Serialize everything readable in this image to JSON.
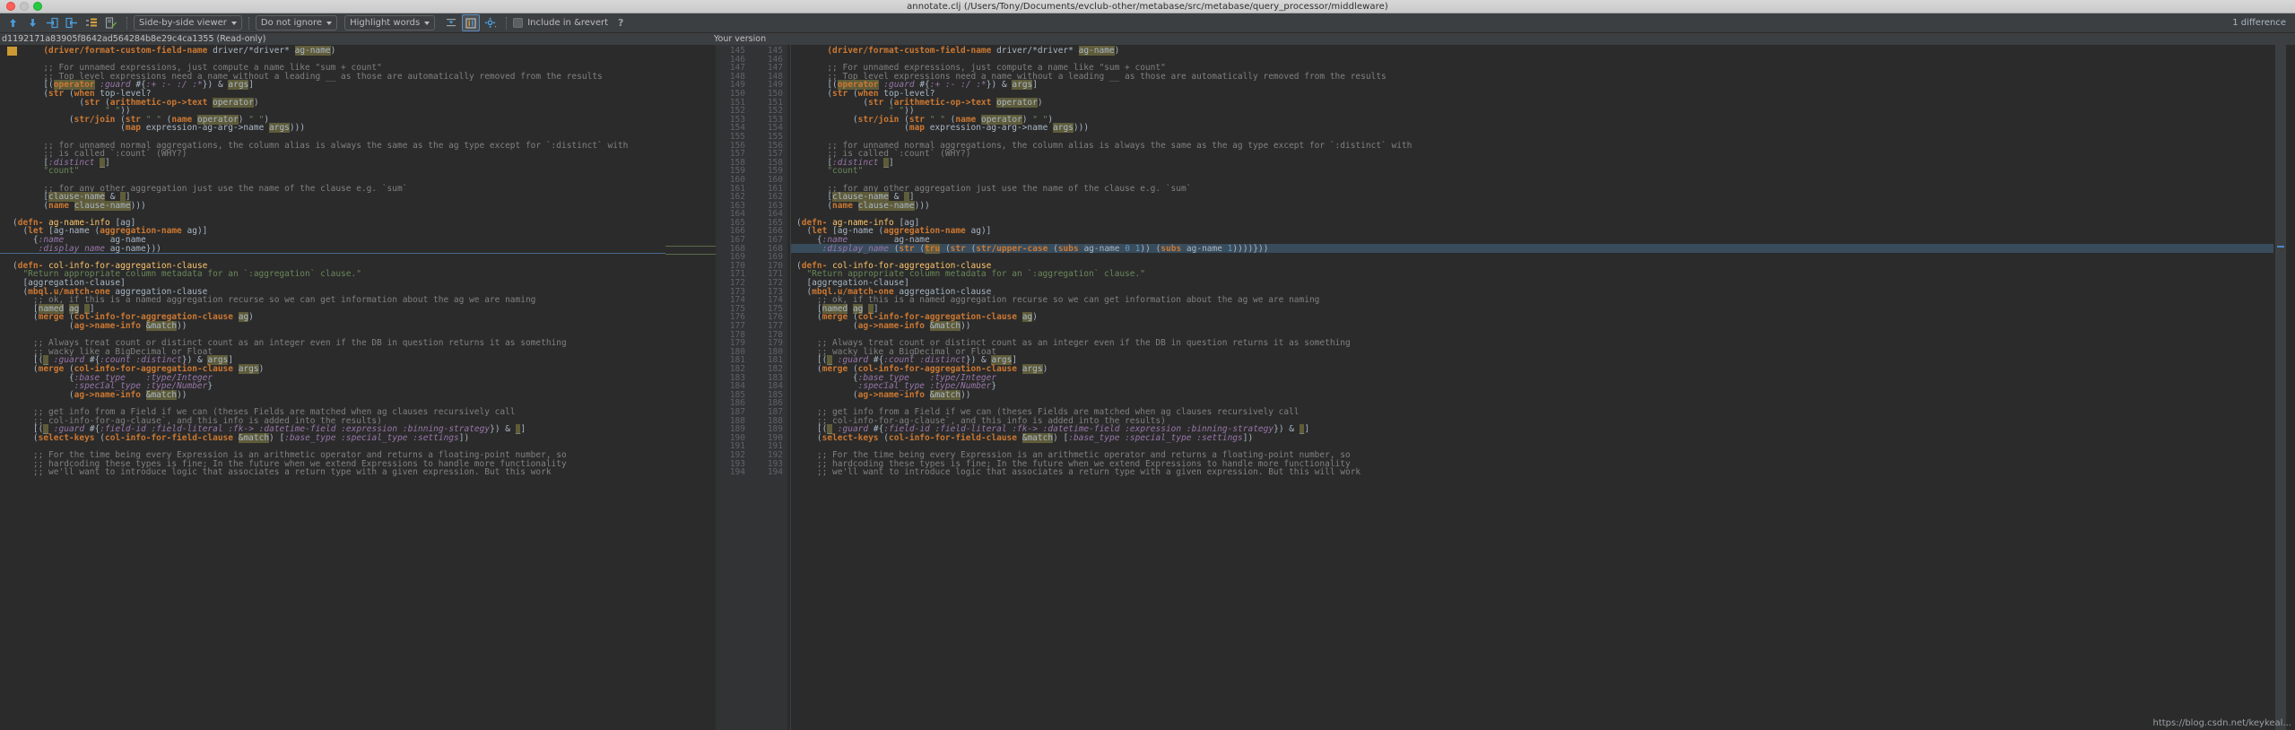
{
  "window": {
    "title": "annotate.clj (/Users/Tony/Documents/evclub-other/metabase/src/metabase/query_processor/middleware)",
    "traffic_lights": [
      "close",
      "minimize",
      "zoom"
    ]
  },
  "toolbar": {
    "icons": [
      {
        "name": "previous-difference-icon",
        "glyph": "arrow-up"
      },
      {
        "name": "next-difference-icon",
        "glyph": "arrow-down"
      },
      {
        "name": "accept-left-icon",
        "glyph": "arrow-to-left"
      },
      {
        "name": "accept-right-icon",
        "glyph": "arrow-to-right"
      },
      {
        "name": "collapse-unchanged-icon",
        "glyph": "collapse"
      },
      {
        "name": "edit-source-icon",
        "glyph": "pencil"
      }
    ],
    "viewer_mode": "Side-by-side viewer",
    "ignore_policy": "Do not ignore",
    "highlight_policy": "Highlight words",
    "toggle_icons": [
      {
        "name": "collapse-lines-icon",
        "glyph": "collapse-lines",
        "active": false
      },
      {
        "name": "show-diff-markers-icon",
        "glyph": "diff-markers",
        "active": true
      },
      {
        "name": "settings-gear-icon",
        "glyph": "gear",
        "active": false
      }
    ],
    "include_in_revert_label": "Include in &revert",
    "include_in_revert_checked": false,
    "help_label": "?",
    "difference_count": "1 difference"
  },
  "panes": {
    "left_header": "d1192171a83905f8642ad564284b8e29c4ca1355 (Read-only)",
    "right_header": "Your version"
  },
  "left_code": [
    {
      "ln": "",
      "html": "      <span class=\"c-fn\">(driver/format-custom-field-name</span> driver/*driver* <span class=\"hl\">ag-name</span>)"
    },
    {
      "ln": "",
      "html": ""
    },
    {
      "ln": "",
      "html": "      <span class=\"c-comment\">;; For unnamed expressions, just compute a name like \"sum + count\"</span>"
    },
    {
      "ln": "",
      "html": "      <span class=\"c-comment\">;; Top level expressions need a name without a leading __ as those are automatically removed from the results</span>"
    },
    {
      "ln": "",
      "html": "      [(<span class=\"hl c-fn\">operator</span> <span class=\"c-key\">:guard</span> #{<span class=\"c-key\">:+</span> <span class=\"c-key\">:-</span> <span class=\"c-key\">:/</span> <span class=\"c-key\">:*</span>}) &amp; <span class=\"hl\">args</span>]"
    },
    {
      "ln": "",
      "html": "      (<span class=\"c-fn\">str</span> (<span class=\"c-kw\">when</span> top-level?"
    },
    {
      "ln": "",
      "html": "             (<span class=\"c-fn\">str</span> (<span class=\"c-fn\">arithmetic-op-&gt;text</span> <span class=\"hl\">operator</span>)"
    },
    {
      "ln": "",
      "html": "                  <span class=\"c-str\">\" \"</span>))"
    },
    {
      "ln": "",
      "html": "           (<span class=\"c-fn\">str/join</span> (<span class=\"c-fn\">str</span> <span class=\"c-str\">\" \"</span> (<span class=\"c-fn\">name</span> <span class=\"hl\">operator</span>) <span class=\"c-str\">\" \"</span>)"
    },
    {
      "ln": "",
      "html": "                     (<span class=\"c-fn\">map</span> expression-ag-arg-&gt;name <span class=\"hl\">args</span>)))"
    },
    {
      "ln": "",
      "html": ""
    },
    {
      "ln": "",
      "html": "      <span class=\"c-comment\">;; for unnamed normal aggregations, the column alias is always the same as the ag type except for `:distinct` with</span>"
    },
    {
      "ln": "",
      "html": "      <span class=\"c-comment\">;; is called `:count` (WHY?)</span>"
    },
    {
      "ln": "",
      "html": "      [<span class=\"c-key\">:distinct</span> <span class=\"hl\">_</span>]"
    },
    {
      "ln": "",
      "html": "      <span class=\"c-str\">\"count\"</span>"
    },
    {
      "ln": "",
      "html": ""
    },
    {
      "ln": "",
      "html": "      <span class=\"c-comment\">;; for any other aggregation just use the name of the clause e.g. `sum`</span>"
    },
    {
      "ln": "",
      "html": "      [<span class=\"hl\">clause-name</span> &amp; <span class=\"hl\">_</span>]"
    },
    {
      "ln": "",
      "html": "      (<span class=\"c-fn\">name</span> <span class=\"hl\">clause-name</span>)))"
    },
    {
      "ln": "",
      "html": ""
    },
    {
      "ln": "",
      "html": "(<span class=\"c-kw\">defn-</span> <span class=\"c-def\">ag-name-info</span> [ag]"
    },
    {
      "ln": "",
      "html": "  (<span class=\"c-kw\">let</span> [ag-name (<span class=\"c-fn\">aggregation-name</span> ag)]"
    },
    {
      "ln": "",
      "html": "    {<span class=\"c-key\">:name</span>         ag-name"
    },
    {
      "ln": "",
      "html": "     <span class=\"c-key\">:display_name</span> ag-name}))"
    },
    {
      "ln": "",
      "html": ""
    },
    {
      "ln": "",
      "html": "(<span class=\"c-kw\">defn-</span> <span class=\"c-def\">col-info-for-aggregation-clause</span>"
    },
    {
      "ln": "",
      "html": "  <span class=\"c-str\">\"Return appropriate column metadata for an `:aggregation` clause.\"</span>"
    },
    {
      "ln": "",
      "html": "  [aggregation-clause]"
    },
    {
      "ln": "",
      "html": "  (<span class=\"c-fn\">mbql.u/match-one</span> aggregation-clause"
    },
    {
      "ln": "",
      "html": "    <span class=\"c-comment\">;; ok, if this is a named aggregation recurse so we can get information about the ag we are naming</span>"
    },
    {
      "ln": "",
      "html": "    [<span class=\"hl\">named</span> <span class=\"hl\">ag</span> <span class=\"hl\">_</span>]"
    },
    {
      "ln": "",
      "html": "    (<span class=\"c-fn\">merge</span> (<span class=\"c-fn\">col-info-for-aggregation-clause</span> <span class=\"hl\">ag</span>)"
    },
    {
      "ln": "",
      "html": "           (<span class=\"c-fn\">ag-&gt;name-info</span> <span class=\"hl\">&amp;match</span>))"
    },
    {
      "ln": "",
      "html": ""
    },
    {
      "ln": "",
      "html": "    <span class=\"c-comment\">;; Always treat count or distinct count as an integer even if the DB in question returns it as something</span>"
    },
    {
      "ln": "",
      "html": "    <span class=\"c-comment\">;; wacky like a BigDecimal or Float</span>"
    },
    {
      "ln": "",
      "html": "    [(<span class=\"hl\">_</span> <span class=\"c-key\">:guard</span> #{<span class=\"c-key\">:count</span> <span class=\"c-key\">:distinct</span>}) &amp; <span class=\"hl\">args</span>]"
    },
    {
      "ln": "",
      "html": "    (<span class=\"c-fn\">merge</span> (<span class=\"c-fn\">col-info-for-aggregation-clause</span> <span class=\"hl\">args</span>)"
    },
    {
      "ln": "",
      "html": "           {<span class=\"c-key\">:base_type</span>    <span class=\"c-key\">:type/Integer</span>"
    },
    {
      "ln": "",
      "html": "            <span class=\"c-key\">:special_type</span> <span class=\"c-key\">:type/Number</span>}"
    },
    {
      "ln": "",
      "html": "           (<span class=\"c-fn\">ag-&gt;name-info</span> <span class=\"hl\">&amp;match</span>))"
    },
    {
      "ln": "",
      "html": ""
    },
    {
      "ln": "",
      "html": "    <span class=\"c-comment\">;; get info from a Field if we can (theses Fields are matched when ag clauses recursively call</span>"
    },
    {
      "ln": "",
      "html": "    <span class=\"c-comment\">;; col-info-for-ag-clause`, and this info is added into the results)</span>"
    },
    {
      "ln": "",
      "html": "    [(<span class=\"hl\">_</span> <span class=\"c-key\">:guard</span> #{<span class=\"c-key\">:field-id</span> <span class=\"c-key\">:field-literal</span> <span class=\"c-key\">:fk-&gt;</span> <span class=\"c-key\">:datetime-field</span> <span class=\"c-key\">:expression</span> <span class=\"c-key\">:binning-strategy</span>}) &amp; <span class=\"hl\">_</span>]"
    },
    {
      "ln": "",
      "html": "    (<span class=\"c-fn\">select-keys</span> (<span class=\"c-fn\">col-info-for-field-clause</span> <span class=\"hl\">&amp;match</span>) [<span class=\"c-key\">:base_type</span> <span class=\"c-key\">:special_type</span> <span class=\"c-key\">:settings</span>])"
    },
    {
      "ln": "",
      "html": ""
    },
    {
      "ln": "",
      "html": "    <span class=\"c-comment\">;; For the time being every Expression is an arithmetic operator and returns a floating-point number, so</span>"
    },
    {
      "ln": "",
      "html": "    <span class=\"c-comment\">;; hardcoding these types is fine; In the future when we extend Expressions to handle more functionality</span>"
    },
    {
      "ln": "",
      "html": "    <span class=\"c-comment\">;; we'll want to introduce logic that associates a return type with a given expression. But this work</span>"
    }
  ],
  "right_code": [
    {
      "ln": "",
      "html": "      <span class=\"c-fn\">(driver/format-custom-field-name</span> driver/*driver* <span class=\"hl\">ag-name</span>)"
    },
    {
      "ln": "",
      "html": ""
    },
    {
      "ln": "",
      "html": "      <span class=\"c-comment\">;; For unnamed expressions, just compute a name like \"sum + count\"</span>"
    },
    {
      "ln": "",
      "html": "      <span class=\"c-comment\">;; Top level expressions need a name without a leading __ as those are automatically removed from the results</span>"
    },
    {
      "ln": "",
      "html": "      [(<span class=\"hl c-fn\">operator</span> <span class=\"c-key\">:guard</span> #{<span class=\"c-key\">:+</span> <span class=\"c-key\">:-</span> <span class=\"c-key\">:/</span> <span class=\"c-key\">:*</span>}) &amp; <span class=\"hl\">args</span>]"
    },
    {
      "ln": "",
      "html": "      (<span class=\"c-fn\">str</span> (<span class=\"c-kw\">when</span> top-level?"
    },
    {
      "ln": "",
      "html": "             (<span class=\"c-fn\">str</span> (<span class=\"c-fn\">arithmetic-op-&gt;text</span> <span class=\"hl\">operator</span>)"
    },
    {
      "ln": "",
      "html": "                  <span class=\"c-str\">\" \"</span>))"
    },
    {
      "ln": "",
      "html": "           (<span class=\"c-fn\">str/join</span> (<span class=\"c-fn\">str</span> <span class=\"c-str\">\" \"</span> (<span class=\"c-fn\">name</span> <span class=\"hl\">operator</span>) <span class=\"c-str\">\" \"</span>)"
    },
    {
      "ln": "",
      "html": "                     (<span class=\"c-fn\">map</span> expression-ag-arg-&gt;name <span class=\"hl\">args</span>)))"
    },
    {
      "ln": "",
      "html": ""
    },
    {
      "ln": "",
      "html": "      <span class=\"c-comment\">;; for unnamed normal aggregations, the column alias is always the same as the ag type except for `:distinct` with</span>"
    },
    {
      "ln": "",
      "html": "      <span class=\"c-comment\">;; is called `:count` (WHY?)</span>"
    },
    {
      "ln": "",
      "html": "      [<span class=\"c-key\">:distinct</span> <span class=\"hl\">_</span>]"
    },
    {
      "ln": "",
      "html": "      <span class=\"c-str\">\"count\"</span>"
    },
    {
      "ln": "",
      "html": ""
    },
    {
      "ln": "",
      "html": "      <span class=\"c-comment\">;; for any other aggregation just use the name of the clause e.g. `sum`</span>"
    },
    {
      "ln": "",
      "html": "      [<span class=\"hl\">clause-name</span> &amp; <span class=\"hl\">_</span>]"
    },
    {
      "ln": "",
      "html": "      (<span class=\"c-fn\">name</span> <span class=\"hl\">clause-name</span>)))"
    },
    {
      "ln": "",
      "html": ""
    },
    {
      "ln": "",
      "html": "(<span class=\"c-kw\">defn-</span> <span class=\"c-def\">ag-name-info</span> [ag]"
    },
    {
      "ln": "",
      "html": "  (<span class=\"c-kw\">let</span> [ag-name (<span class=\"c-fn\">aggregation-name</span> ag)]"
    },
    {
      "ln": "",
      "html": "    {<span class=\"c-key\">:name</span>         ag-name"
    },
    {
      "ln": "",
      "html": "     <span class=\"c-key\">:display_name</span> (<span class=\"c-fn\">str</span> (<span class=\"c-fn hl2\">tru</span> (<span class=\"c-fn\">str</span> (<span class=\"c-fn\">str/upper-case</span> (<span class=\"c-fn\">subs</span> ag-name <span class=\"c-num\">0</span> <span class=\"c-num\">1</span>)) (<span class=\"c-fn\">subs</span> ag-name <span class=\"c-num\">1</span>))))}))"
    },
    {
      "ln": "",
      "html": ""
    },
    {
      "ln": "",
      "html": "(<span class=\"c-kw\">defn-</span> <span class=\"c-def\">col-info-for-aggregation-clause</span>"
    },
    {
      "ln": "",
      "html": "  <span class=\"c-str\">\"Return appropriate column metadata for an `:aggregation` clause.\"</span>"
    },
    {
      "ln": "",
      "html": "  [aggregation-clause]"
    },
    {
      "ln": "",
      "html": "  (<span class=\"c-fn\">mbql.u/match-one</span> aggregation-clause"
    },
    {
      "ln": "",
      "html": "    <span class=\"c-comment\">;; ok, if this is a named aggregation recurse so we can get information about the ag we are naming</span>"
    },
    {
      "ln": "",
      "html": "    [<span class=\"hl\">named</span> <span class=\"hl\">ag</span> <span class=\"hl\">_</span>]"
    },
    {
      "ln": "",
      "html": "    (<span class=\"c-fn\">merge</span> (<span class=\"c-fn\">col-info-for-aggregation-clause</span> <span class=\"hl\">ag</span>)"
    },
    {
      "ln": "",
      "html": "           (<span class=\"c-fn\">ag-&gt;name-info</span> <span class=\"hl\">&amp;match</span>))"
    },
    {
      "ln": "",
      "html": ""
    },
    {
      "ln": "",
      "html": "    <span class=\"c-comment\">;; Always treat count or distinct count as an integer even if the DB in question returns it as something</span>"
    },
    {
      "ln": "",
      "html": "    <span class=\"c-comment\">;; wacky like a BigDecimal or Float</span>"
    },
    {
      "ln": "",
      "html": "    [(<span class=\"hl\">_</span> <span class=\"c-key\">:guard</span> #{<span class=\"c-key\">:count</span> <span class=\"c-key\">:distinct</span>}) &amp; <span class=\"hl\">args</span>]"
    },
    {
      "ln": "",
      "html": "    (<span class=\"c-fn\">merge</span> (<span class=\"c-fn\">col-info-for-aggregation-clause</span> <span class=\"hl\">args</span>)"
    },
    {
      "ln": "",
      "html": "           {<span class=\"c-key\">:base_type</span>    <span class=\"c-key\">:type/Integer</span>"
    },
    {
      "ln": "",
      "html": "            <span class=\"c-key\">:special_type</span> <span class=\"c-key\">:type/Number</span>}"
    },
    {
      "ln": "",
      "html": "           (<span class=\"c-fn\">ag-&gt;name-info</span> <span class=\"hl\">&amp;match</span>))"
    },
    {
      "ln": "",
      "html": ""
    },
    {
      "ln": "",
      "html": "    <span class=\"c-comment\">;; get info from a Field if we can (theses Fields are matched when ag clauses recursively call</span>"
    },
    {
      "ln": "",
      "html": "    <span class=\"c-comment\">;; col-info-for-ag-clause`, and this info is added into the results)</span>"
    },
    {
      "ln": "",
      "html": "    [(<span class=\"hl\">_</span> <span class=\"c-key\">:guard</span> #{<span class=\"c-key\">:field-id</span> <span class=\"c-key\">:field-literal</span> <span class=\"c-key\">:fk-&gt;</span> <span class=\"c-key\">:datetime-field</span> <span class=\"c-key\">:expression</span> <span class=\"c-key\">:binning-strategy</span>}) &amp; <span class=\"hl\">_</span>]"
    },
    {
      "ln": "",
      "html": "    (<span class=\"c-fn\">select-keys</span> (<span class=\"c-fn\">col-info-for-field-clause</span> <span class=\"hl\">&amp;match</span>) [<span class=\"c-key\">:base_type</span> <span class=\"c-key\">:special_type</span> <span class=\"c-key\">:settings</span>])"
    },
    {
      "ln": "",
      "html": ""
    },
    {
      "ln": "",
      "html": "    <span class=\"c-comment\">;; For the time being every Expression is an arithmetic operator and returns a floating-point number, so</span>"
    },
    {
      "ln": "",
      "html": "    <span class=\"c-comment\">;; hardcoding these types is fine; In the future when we extend Expressions to handle more functionality</span>"
    },
    {
      "ln": "",
      "html": "    <span class=\"c-comment\">;; we'll want to introduce logic that associates a return type with a given expression. But this will work</span>"
    }
  ],
  "line_numbers_left": [
    "145",
    "146",
    "147",
    "148",
    "149",
    "150",
    "151",
    "152",
    "153",
    "154",
    "155",
    "156",
    "157",
    "158",
    "159",
    "160",
    "161",
    "162",
    "163",
    "164",
    "165",
    "166",
    "167",
    "168",
    "169",
    "170",
    "171",
    "172",
    "173",
    "174",
    "175",
    "176",
    "177",
    "178",
    "179",
    "180",
    "181",
    "182",
    "183",
    "184",
    "185",
    "186",
    "187",
    "188",
    "189",
    "190",
    "191",
    "192",
    "193",
    "194"
  ],
  "line_numbers_right": [
    "145",
    "146",
    "147",
    "148",
    "149",
    "150",
    "151",
    "152",
    "153",
    "154",
    "155",
    "156",
    "157",
    "158",
    "159",
    "160",
    "161",
    "162",
    "163",
    "164",
    "165",
    "166",
    "167",
    "168",
    "169",
    "170",
    "171",
    "172",
    "173",
    "174",
    "175",
    "176",
    "177",
    "178",
    "179",
    "180",
    "181",
    "182",
    "183",
    "184",
    "185",
    "186",
    "187",
    "188",
    "189",
    "190",
    "191",
    "192",
    "193",
    "194"
  ],
  "watermark": "https://blog.csdn.net/keykeal...",
  "colors": {
    "background": "#2b2b2b",
    "toolbar": "#3c3f41",
    "gutter": "#313335",
    "accent_blue": "#4a88c7",
    "highlight": "#5f5c3a",
    "keyword": "#cc7832",
    "string": "#6a8759",
    "symbol": "#9876aa",
    "comment": "#808080",
    "text": "#a9b7c6"
  }
}
